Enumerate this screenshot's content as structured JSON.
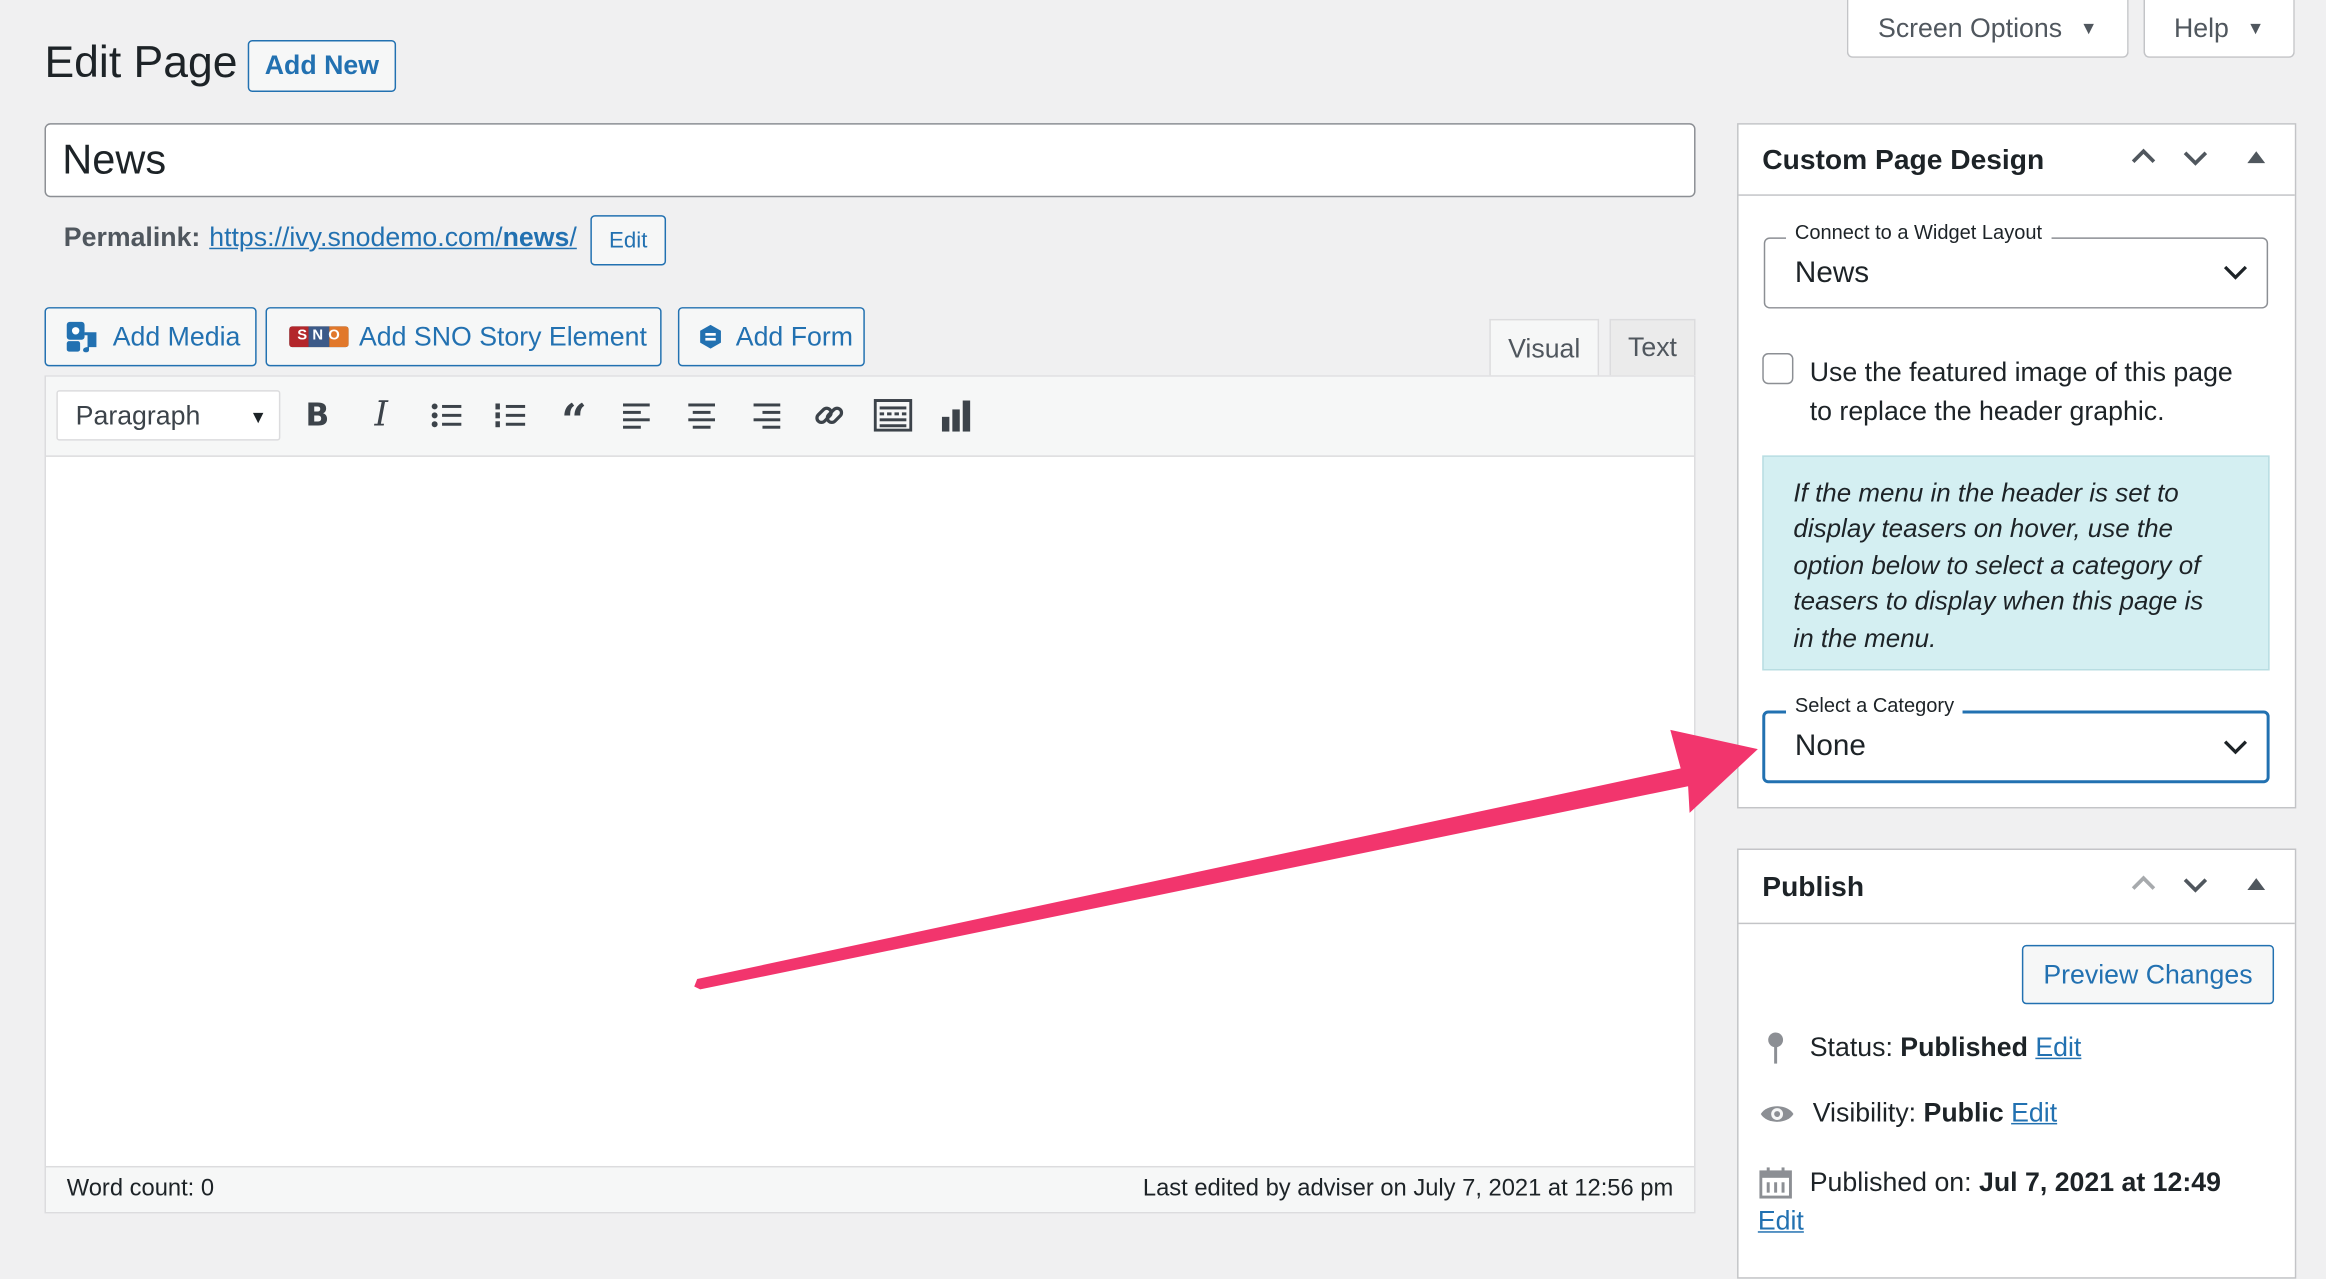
{
  "header": {
    "title": "Edit Page",
    "add_new": "Add New",
    "screen_options": "Screen Options",
    "help": "Help"
  },
  "title_field": {
    "value": "News"
  },
  "permalink": {
    "label": "Permalink:",
    "url_base": "https://ivy.snodemo.com/",
    "slug": "news",
    "trailing": "/",
    "edit": "Edit"
  },
  "media_buttons": {
    "add_media": "Add Media",
    "sno_badge": "SNO",
    "add_sno": "Add SNO Story Element",
    "add_form": "Add Form"
  },
  "editor_tabs": {
    "visual": "Visual",
    "text": "Text"
  },
  "toolbar": {
    "format": "Paragraph",
    "icons": [
      "bold-icon",
      "italic-icon",
      "bullet-list-icon",
      "numbered-list-icon",
      "blockquote-icon",
      "align-left-icon",
      "align-center-icon",
      "align-right-icon",
      "link-icon",
      "toolbar-toggle-icon",
      "chart-icon"
    ]
  },
  "status_bar": {
    "word_count": "Word count: 0",
    "last_edited": "Last edited by adviser on July 7, 2021 at 12:56 pm"
  },
  "custom_design": {
    "title": "Custom Page Design",
    "layout_label": "Connect to a Widget Layout",
    "layout_value": "News",
    "featured_checkbox_line1": "Use the featured image of this page",
    "featured_checkbox_line2": "to replace the header graphic.",
    "featured_checked": false,
    "info_lines": [
      "If the menu in the header is set to",
      "display teasers on hover, use the",
      "option below to select a category of",
      "teasers to display when this page is",
      "in the menu."
    ],
    "category_label": "Select a Category",
    "category_value": "None"
  },
  "publish": {
    "title": "Publish",
    "preview": "Preview Changes",
    "status_label": "Status:",
    "status_value": "Published",
    "visibility_label": "Visibility:",
    "visibility_value": "Public",
    "published_label": "Published on:",
    "published_value": "Jul 7, 2021 at 12:49",
    "edit": "Edit"
  },
  "colors": {
    "accent": "#2271b1",
    "annotation_arrow": "#f2356d",
    "info_bg": "#d4eff2",
    "bg": "#f0f0f1"
  }
}
